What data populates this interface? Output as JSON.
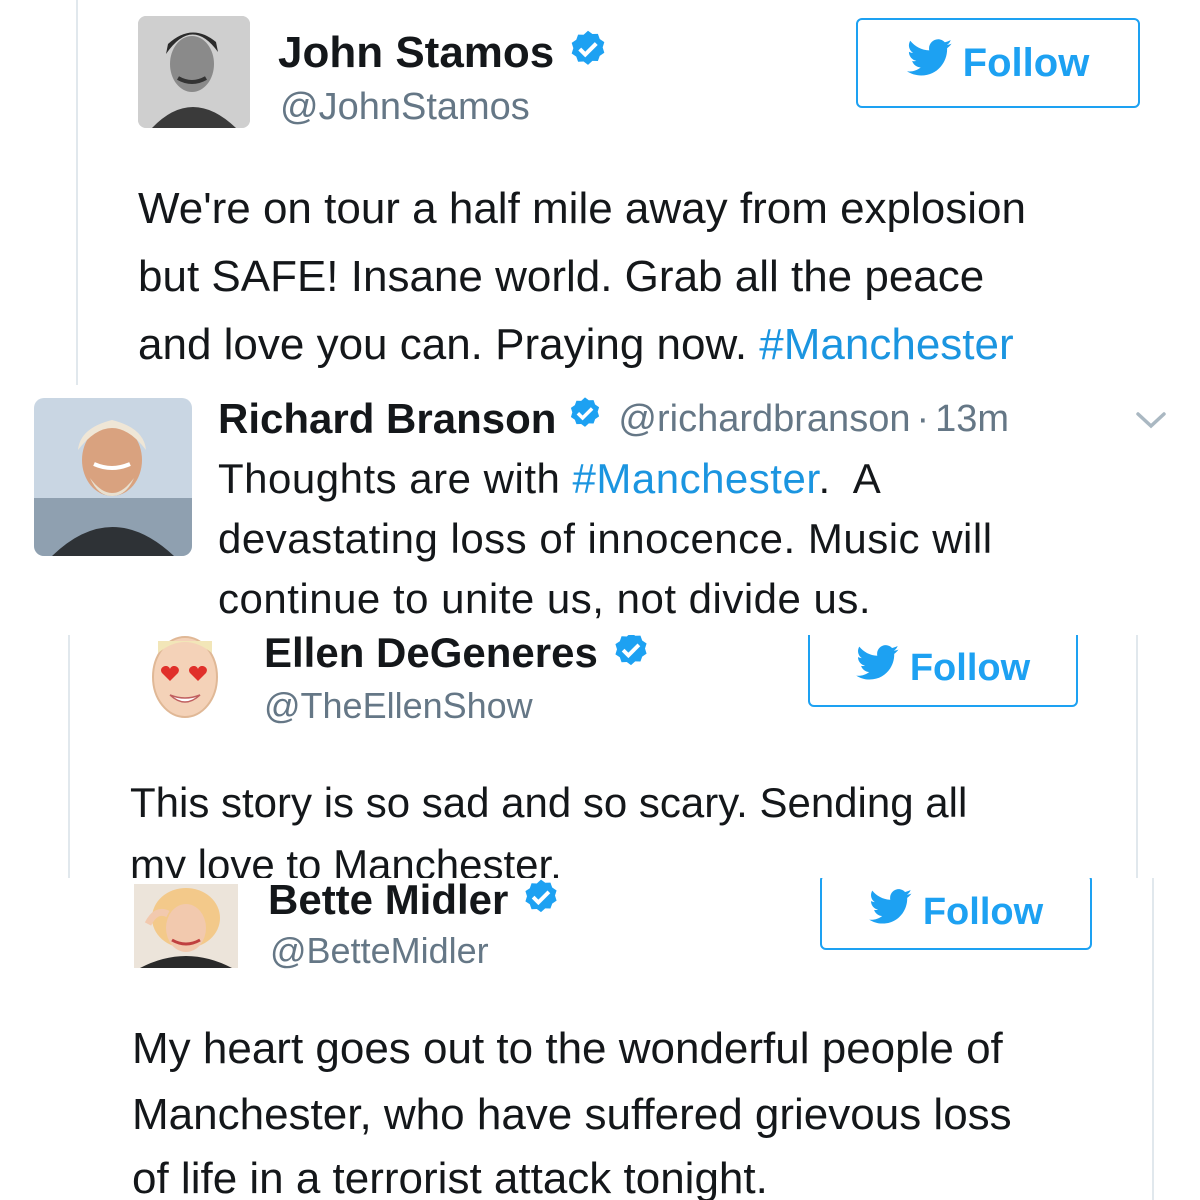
{
  "follow_label": "Follow",
  "colors": {
    "twitter_blue": "#1da1f2",
    "hashtag": "#1b95e0",
    "handle_gray": "#657786",
    "text": "#14171a"
  },
  "tweets": [
    {
      "name": "John Stamos",
      "handle": "@JohnStamos",
      "verified": true,
      "lines": [
        "We're on tour a half mile away from explosion",
        "but SAFE! Insane world. Grab all the peace"
      ],
      "line3_text": "and love you can. Praying now. ",
      "line3_hashtag": "#Manchester"
    },
    {
      "name": "Richard Branson",
      "handle": "@richardbranson",
      "time_separator": "·",
      "time": "13m",
      "line1_text": "Thoughts are with ",
      "line1_hashtag": "#Manchester",
      "line1_tail": ".  A",
      "lines": [
        "devastating loss of innocence. Music will",
        "continue to unite us, not divide us."
      ]
    },
    {
      "name": "Ellen DeGeneres",
      "handle": "@TheEllenShow",
      "lines": [
        "This story is so sad and so scary. Sending all",
        "my love to Manchester."
      ]
    },
    {
      "name": "Bette Midler",
      "handle": "@BetteMidler",
      "lines": [
        "My heart goes out to the wonderful people of",
        "Manchester, who have suffered grievous loss",
        "of life in a terrorist attack tonight."
      ]
    }
  ]
}
